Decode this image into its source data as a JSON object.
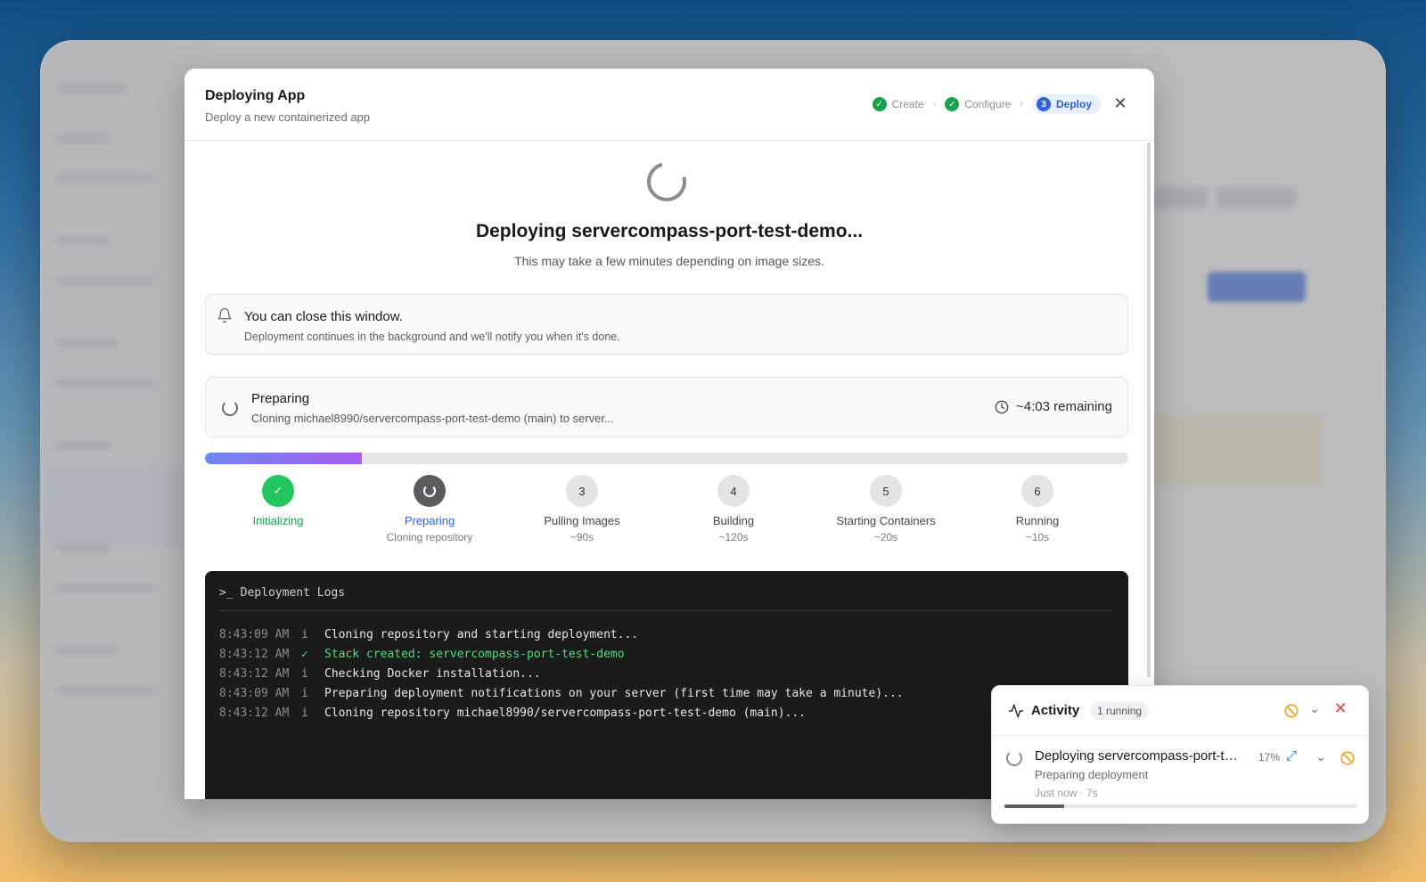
{
  "dialog": {
    "title": "Deploying App",
    "subtitle": "Deploy a new containerized app",
    "stepper": [
      {
        "label": "Create",
        "state": "done"
      },
      {
        "label": "Configure",
        "state": "done"
      },
      {
        "label": "Deploy",
        "state": "active",
        "number": "3"
      }
    ],
    "heading": "Deploying servercompass-port-test-demo...",
    "subheading": "This may take a few minutes depending on image sizes.",
    "notice": {
      "title": "You can close this window.",
      "text": "Deployment continues in the background and we'll notify you when it's done."
    },
    "stage": {
      "title": "Preparing",
      "detail": "Cloning michael8990/servercompass-port-test-demo (main) to server...",
      "remaining": "~4:03 remaining"
    },
    "progress_fraction": 0.17,
    "steps": [
      {
        "label": "Initializing",
        "sub": "",
        "state": "done",
        "number": ""
      },
      {
        "label": "Preparing",
        "sub": "Cloning repository",
        "state": "current",
        "number": ""
      },
      {
        "label": "Pulling Images",
        "sub": "~90s",
        "state": "pending",
        "number": "3"
      },
      {
        "label": "Building",
        "sub": "~120s",
        "state": "pending",
        "number": "4"
      },
      {
        "label": "Starting Containers",
        "sub": "~20s",
        "state": "pending",
        "number": "5"
      },
      {
        "label": "Running",
        "sub": "~10s",
        "state": "pending",
        "number": "6"
      }
    ],
    "logs": {
      "title": "Deployment Logs",
      "lines": [
        {
          "time": "8:43:09 AM",
          "icon": "i",
          "type": "info",
          "text": "Cloning repository and starting deployment..."
        },
        {
          "time": "8:43:12 AM",
          "icon": "check-circle",
          "type": "success",
          "text": "Stack created: servercompass-port-test-demo"
        },
        {
          "time": "8:43:12 AM",
          "icon": "i",
          "type": "info",
          "text": "Checking Docker installation..."
        },
        {
          "time": "8:43:09 AM",
          "icon": "i",
          "type": "info",
          "text": "Preparing deployment notifications on your server (first time may take a minute)..."
        },
        {
          "time": "8:43:12 AM",
          "icon": "i",
          "type": "info",
          "text": "Cloning repository michael8990/servercompass-port-test-demo (main)..."
        }
      ]
    }
  },
  "activity": {
    "title": "Activity",
    "badge": "1 running",
    "item": {
      "title": "Deploying servercompass-port-test-demo",
      "percent": "17%",
      "progress_fraction": 0.17,
      "status": "Preparing deployment",
      "time": "Just now  ·  7s"
    }
  },
  "colors": {
    "accent": "#2b63e0",
    "success": "#16a34a",
    "warning": "#f59e0b",
    "danger": "#ef4444",
    "log_bg": "#1b1b1b"
  }
}
